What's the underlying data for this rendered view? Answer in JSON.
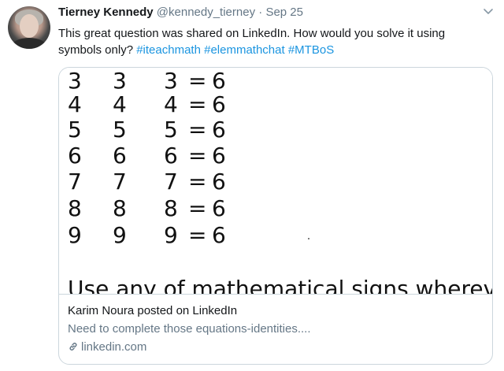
{
  "tweet": {
    "author_name": "Tierney Kennedy",
    "handle": "@kennedy_tierney",
    "separator": "·",
    "date": "Sep 25",
    "text": "This great question was shared on LinkedIn. How would you solve it using symbols only? ",
    "hashtags": [
      "#iteachmath",
      "#elemmathchat",
      "#MTBoS"
    ]
  },
  "card": {
    "puzzle_rows": [
      [
        "3",
        "3",
        "3",
        "=",
        "6"
      ],
      [
        "4",
        "4",
        "4",
        "=",
        "6"
      ],
      [
        "5",
        "5",
        "5",
        "=",
        "6"
      ],
      [
        "6",
        "6",
        "6",
        "=",
        "6"
      ],
      [
        "7",
        "7",
        "7",
        "=",
        "6"
      ],
      [
        "8",
        "8",
        "8",
        "=",
        "6"
      ],
      [
        "9",
        "9",
        "9",
        "=",
        "6"
      ]
    ],
    "instruction_text": "Use any of mathematical signs wherever",
    "title": "Karim Noura posted on LinkedIn",
    "description": "Need to complete those equations-identities....",
    "domain": "linkedin.com"
  },
  "icons": {
    "more": "chevron-down-icon",
    "link": "link-icon",
    "avatar": "profile-photo"
  },
  "colors": {
    "text": "#14171a",
    "muted": "#657786",
    "link": "#1b95e0",
    "border": "#ccd6dd"
  }
}
